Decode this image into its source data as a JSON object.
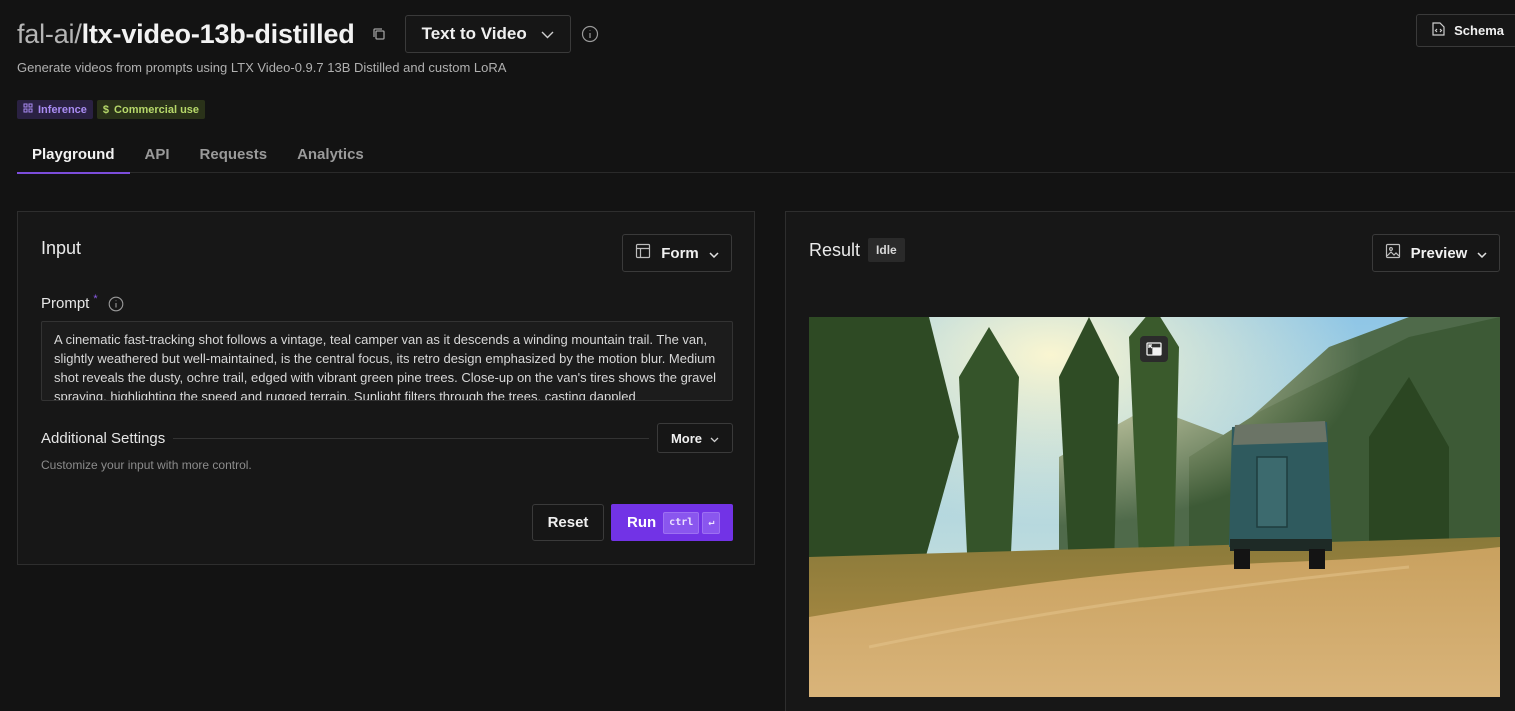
{
  "header": {
    "org": "fal-ai/",
    "model": "ltx-video-13b-distilled",
    "mode_label": "Text to Video",
    "schema_label": "Schema"
  },
  "subtitle": "Generate videos from prompts using LTX Video-0.9.7 13B Distilled and custom LoRA",
  "badges": [
    {
      "label": "Inference",
      "icon": "grid-icon",
      "color": "#a98cf2"
    },
    {
      "label": "Commercial use",
      "icon": "dollar-icon",
      "color": "#b6d86a"
    }
  ],
  "tabs": [
    {
      "label": "Playground",
      "active": true
    },
    {
      "label": "API",
      "active": false
    },
    {
      "label": "Requests",
      "active": false
    },
    {
      "label": "Analytics",
      "active": false
    }
  ],
  "input": {
    "title": "Input",
    "form_label": "Form",
    "prompt_label": "Prompt",
    "required_mark": "*",
    "prompt_value": "A cinematic fast-tracking shot follows a vintage, teal camper van as it descends a winding mountain trail. The van, slightly weathered but well-maintained, is the central focus, its retro design emphasized by the motion blur. Medium shot reveals the dusty, ochre trail, edged with vibrant green pine trees. Close-up on the van's tires shows the gravel spraying, highlighting the speed and rugged terrain. Sunlight filters through the trees, casting dappled",
    "settings_title": "Additional Settings",
    "more_label": "More",
    "settings_desc": "Customize your input with more control.",
    "reset_label": "Reset",
    "run_label": "Run",
    "kbd_ctrl": "ctrl",
    "kbd_enter": "↵"
  },
  "result": {
    "title": "Result",
    "status": "Idle",
    "preview_label": "Preview"
  },
  "colors": {
    "accent": "#7233e6",
    "background": "#131313"
  }
}
